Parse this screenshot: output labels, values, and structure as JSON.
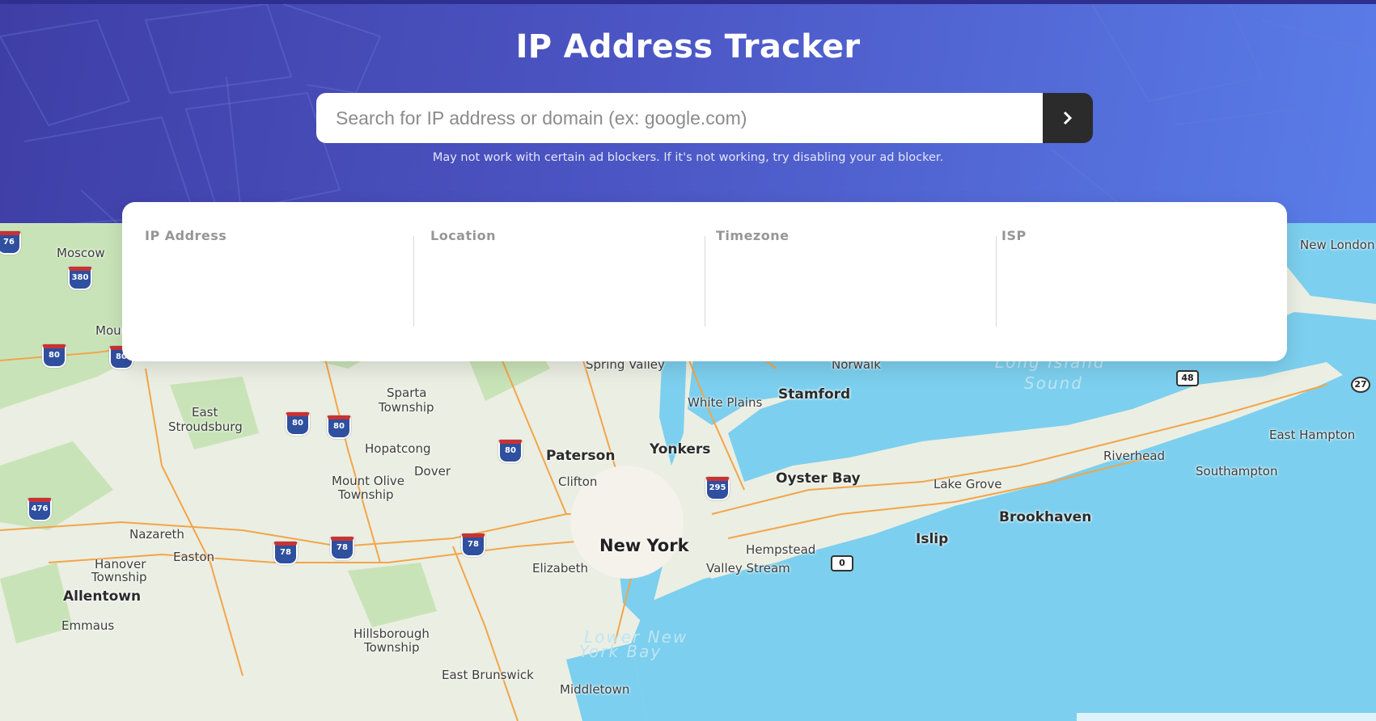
{
  "header": {
    "title": "IP Address Tracker",
    "note": "May not work with certain ad blockers. If it's not working, try disabling your ad blocker."
  },
  "search": {
    "placeholder": "Search for IP address or domain (ex: google.com)",
    "value": "",
    "submit_icon": "chevron-right-icon"
  },
  "info": {
    "ip_label": "IP Address",
    "ip_value": "",
    "location_label": "Location",
    "location_value": "",
    "timezone_label": "Timezone",
    "timezone_value": "",
    "isp_label": "ISP",
    "isp_value": ""
  },
  "map": {
    "labels": {
      "new_york": "New York",
      "yonkers": "Yonkers",
      "paterson": "Paterson",
      "clifton": "Clifton",
      "elizabeth": "Elizabeth",
      "white_plains": "White Plains",
      "stamford": "Stamford",
      "oyster_bay": "Oyster Bay",
      "hempstead": "Hempstead",
      "valley_stream": "Valley Stream",
      "brookhaven": "Brookhaven",
      "islip": "Islip",
      "lake_grove": "Lake Grove",
      "riverhead": "Riverhead",
      "southampton": "Southampton",
      "east_hampton": "East Hampton",
      "new_london": "New London",
      "moscow": "Moscow",
      "east_stroudsburg_1": "East",
      "east_stroudsburg_2": "Stroudsburg",
      "sparta_1": "Sparta",
      "sparta_2": "Township",
      "hopatcong": "Hopatcong",
      "dover": "Dover",
      "mount_olive_1": "Mount Olive",
      "mount_olive_2": "Township",
      "nazareth": "Nazareth",
      "easton": "Easton",
      "hanover_1": "Hanover",
      "hanover_2": "Township",
      "allentown": "Allentown",
      "emmaus": "Emmaus",
      "hillsborough_1": "Hillsborough",
      "hillsborough_2": "Township",
      "east_brunswick": "East Brunswick",
      "middletown": "Middletown",
      "spring_valley": "Spring Valley",
      "norwalk": "Norwalk",
      "mount_pocono": "Mount Pocono",
      "long_island_sound_1": "Long Island",
      "long_island_sound_2": "Sound",
      "lower_ny_bay_1": "Lower New",
      "lower_ny_bay_2": "York Bay"
    },
    "shields": {
      "i380": "380",
      "i80a": "80",
      "i80b": "80",
      "i80c": "80",
      "i80d": "80",
      "i80e": "80",
      "i476": "476",
      "i78a": "78",
      "i78b": "78",
      "i78c": "78",
      "i295": "295",
      "i76": "76",
      "r48": "48",
      "r27": "27",
      "r0": "0"
    }
  }
}
